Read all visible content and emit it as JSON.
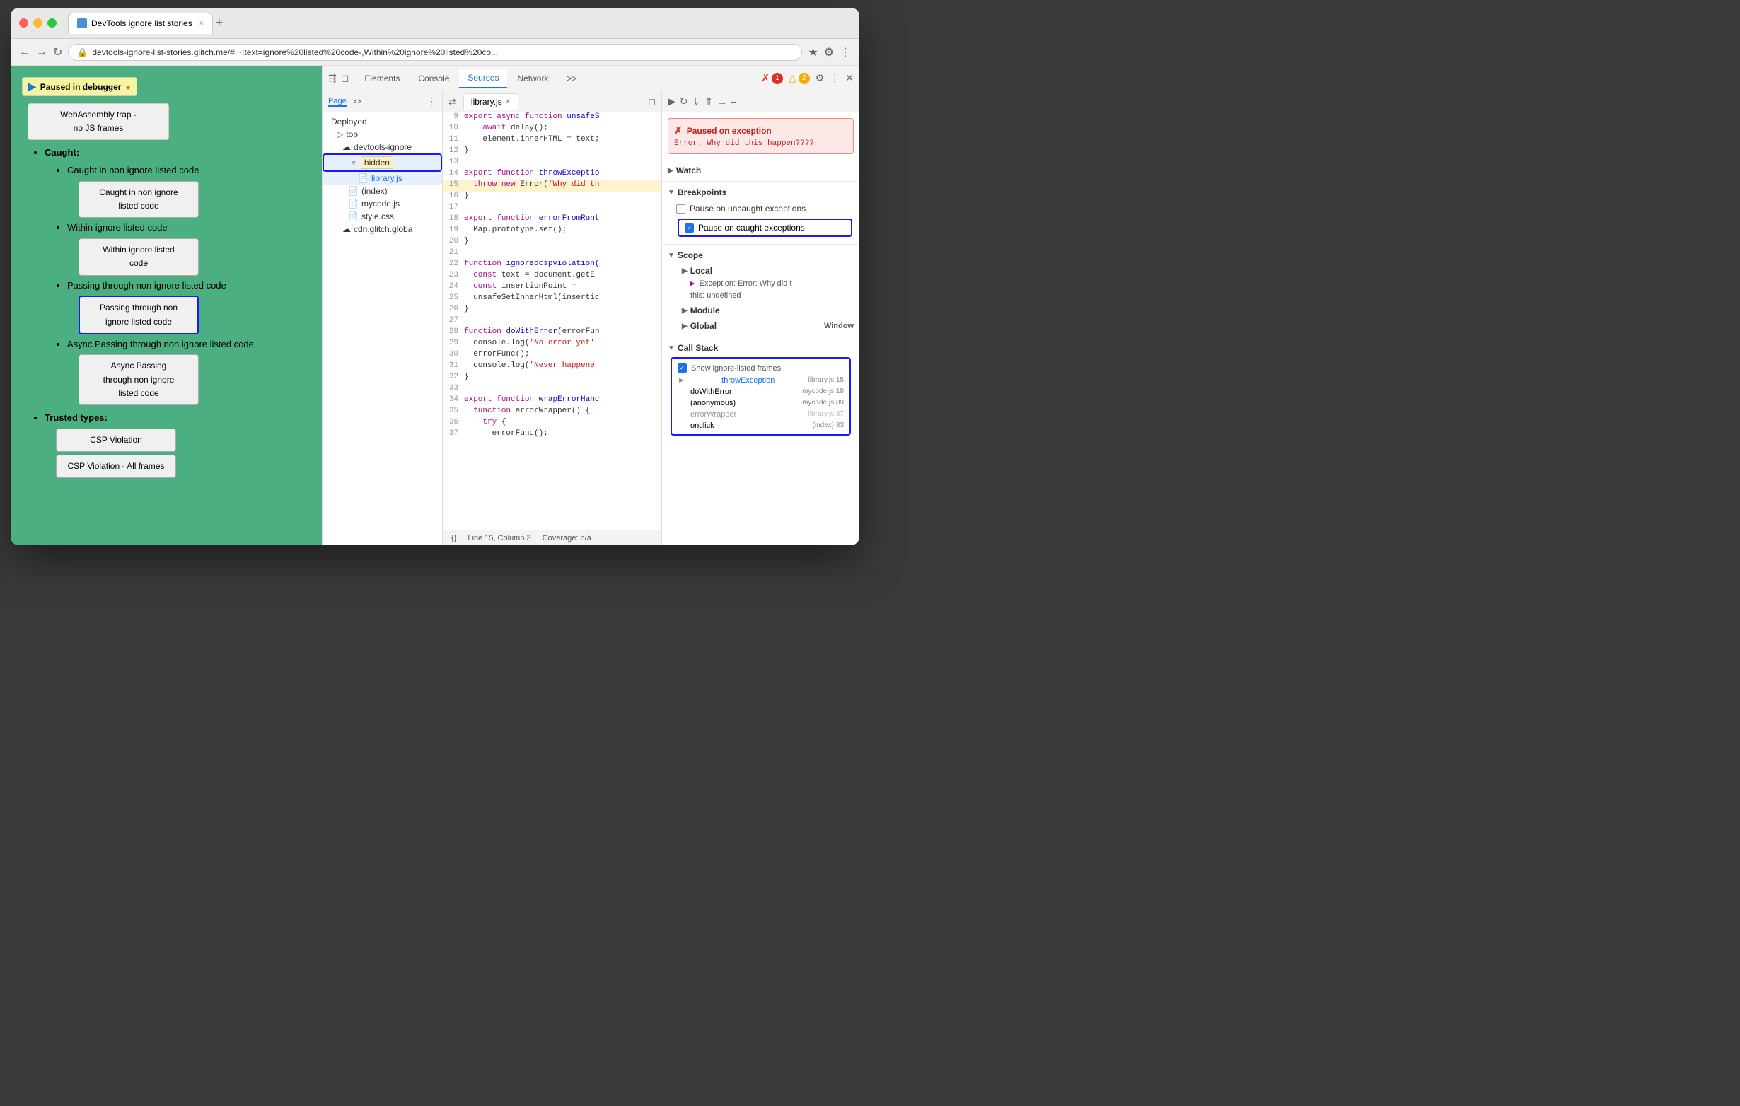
{
  "browser": {
    "title": "DevTools ignore list stories",
    "url": "devtools-ignore-list-stories.glitch.me/#:~:text=ignore%20listed%20code-,Within%20ignore%20listed%20co...",
    "tab_close": "×",
    "tab_new": "+"
  },
  "page": {
    "paused_label": "Paused in debugger",
    "items": [
      {
        "type": "heading",
        "level": "wasm",
        "text": "WebAssembly trap - no JS frames"
      },
      {
        "type": "subheading",
        "text": "Caught:"
      },
      {
        "type": "bullet",
        "text": "Caught in non ignore listed code"
      },
      {
        "type": "button",
        "text": "Caught in non ignore\nlisted code",
        "highlighted": false
      },
      {
        "type": "bullet",
        "text": "Within ignore listed code"
      },
      {
        "type": "button",
        "text": "Within ignore listed\ncode",
        "highlighted": false
      },
      {
        "type": "bullet",
        "text": "Passing through non ignore listed code"
      },
      {
        "type": "button",
        "text": "Passing through non\nignore listed code",
        "highlighted": true
      },
      {
        "type": "bullet",
        "text": "Async Passing through non ignore listed code"
      },
      {
        "type": "button",
        "text": "Async Passing\nthrough non ignore\nlisted code",
        "highlighted": false
      },
      {
        "type": "heading2",
        "text": "Trusted types:"
      },
      {
        "type": "button2",
        "text": "CSP Violation"
      },
      {
        "type": "button2",
        "text": "CSP Violation - All frames"
      }
    ]
  },
  "devtools": {
    "tabs": [
      "Elements",
      "Console",
      "Sources",
      "Network",
      ">>"
    ],
    "active_tab": "Sources",
    "error_count": "1",
    "warn_count": "2"
  },
  "sources_sidebar": {
    "tabs": [
      "Page",
      ">>"
    ],
    "active_tab": "Page",
    "items": [
      {
        "type": "section",
        "label": "Deployed",
        "indent": 0
      },
      {
        "type": "item",
        "label": "top",
        "indent": 1,
        "icon": "folder"
      },
      {
        "type": "item",
        "label": "devtools-ignore",
        "indent": 2,
        "icon": "cloud"
      },
      {
        "type": "folder",
        "label": "hidden",
        "indent": 3,
        "icon": "folder",
        "highlighted": true
      },
      {
        "type": "item",
        "label": "library.js",
        "indent": 4,
        "icon": "js",
        "selected": true
      },
      {
        "type": "item",
        "label": "(index)",
        "indent": 3,
        "icon": "page"
      },
      {
        "type": "item",
        "label": "mycode.js",
        "indent": 3,
        "icon": "js-orange"
      },
      {
        "type": "item",
        "label": "style.css",
        "indent": 3,
        "icon": "css"
      },
      {
        "type": "item",
        "label": "cdn.glitch.globa",
        "indent": 2,
        "icon": "cloud"
      }
    ]
  },
  "editor": {
    "tab_filename": "library.js",
    "lines": [
      {
        "num": 9,
        "content": "  export async function unsafeS",
        "highlighted": false
      },
      {
        "num": 10,
        "content": "    await delay();",
        "highlighted": false
      },
      {
        "num": 11,
        "content": "    element.innerHTML = text;",
        "highlighted": false
      },
      {
        "num": 12,
        "content": "}",
        "highlighted": false
      },
      {
        "num": 13,
        "content": "",
        "highlighted": false
      },
      {
        "num": 14,
        "content": "export function throwExceptio",
        "highlighted": false
      },
      {
        "num": 15,
        "content": "  throw new Error('Why did th",
        "highlighted": true
      },
      {
        "num": 16,
        "content": "}",
        "highlighted": false
      },
      {
        "num": 17,
        "content": "",
        "highlighted": false
      },
      {
        "num": 18,
        "content": "export function errorFromRunt",
        "highlighted": false
      },
      {
        "num": 19,
        "content": "  Map.prototype.set();",
        "highlighted": false
      },
      {
        "num": 20,
        "content": "}",
        "highlighted": false
      },
      {
        "num": 21,
        "content": "",
        "highlighted": false
      },
      {
        "num": 22,
        "content": "function ignoredcspviolation(",
        "highlighted": false
      },
      {
        "num": 23,
        "content": "  const text = document.getE",
        "highlighted": false
      },
      {
        "num": 24,
        "content": "  const insertionPoint =",
        "highlighted": false
      },
      {
        "num": 25,
        "content": "  unsafeSetInnerHtml(insertic",
        "highlighted": false
      },
      {
        "num": 26,
        "content": "}",
        "highlighted": false
      },
      {
        "num": 27,
        "content": "",
        "highlighted": false
      },
      {
        "num": 28,
        "content": "function doWithError(errorFun",
        "highlighted": false
      },
      {
        "num": 29,
        "content": "  console.log('No error yet'",
        "highlighted": false
      },
      {
        "num": 30,
        "content": "  errorFunc();",
        "highlighted": false
      },
      {
        "num": 31,
        "content": "  console.log('Never happene",
        "highlighted": false
      },
      {
        "num": 32,
        "content": "}",
        "highlighted": false
      },
      {
        "num": 33,
        "content": "",
        "highlighted": false
      },
      {
        "num": 34,
        "content": "export function wrapErrorHanc",
        "highlighted": false
      },
      {
        "num": 35,
        "content": "  function errorWrapper() {",
        "highlighted": false
      },
      {
        "num": 36,
        "content": "    try {",
        "highlighted": false
      },
      {
        "num": 37,
        "content": "      errorFunc();",
        "highlighted": false
      }
    ],
    "status_line": "Line 15, Column 3",
    "status_coverage": "Coverage: n/a"
  },
  "right_panel": {
    "exception": {
      "title": "Paused on exception",
      "message": "Error: Why did this\nhappen????"
    },
    "sections": {
      "watch": "Watch",
      "breakpoints": "Breakpoints",
      "pause_uncaught": "Pause on uncaught exceptions",
      "pause_caught": "Pause on caught exceptions",
      "pause_uncaught_checked": false,
      "pause_caught_checked": true,
      "scope": "Scope",
      "local": "Local",
      "exception_var": "Exception: Error: Why did t",
      "this_val": "this: undefined",
      "module": "Module",
      "global": "Global",
      "global_val": "Window",
      "call_stack": "Call Stack",
      "show_ignored": "Show ignore-listed frames",
      "show_ignored_checked": true,
      "call_stack_items": [
        {
          "fn": "throwException",
          "loc": "library.js:15",
          "active": true,
          "dimmed": false
        },
        {
          "fn": "doWithError",
          "loc": "mycode.js:18",
          "active": false,
          "dimmed": false
        },
        {
          "fn": "(anonymous)",
          "loc": "mycode.js:89",
          "active": false,
          "dimmed": false
        },
        {
          "fn": "errorWrapper",
          "loc": "library.js:37",
          "active": false,
          "dimmed": true
        },
        {
          "fn": "onclick",
          "loc": "(index):83",
          "active": false,
          "dimmed": false
        }
      ]
    }
  }
}
